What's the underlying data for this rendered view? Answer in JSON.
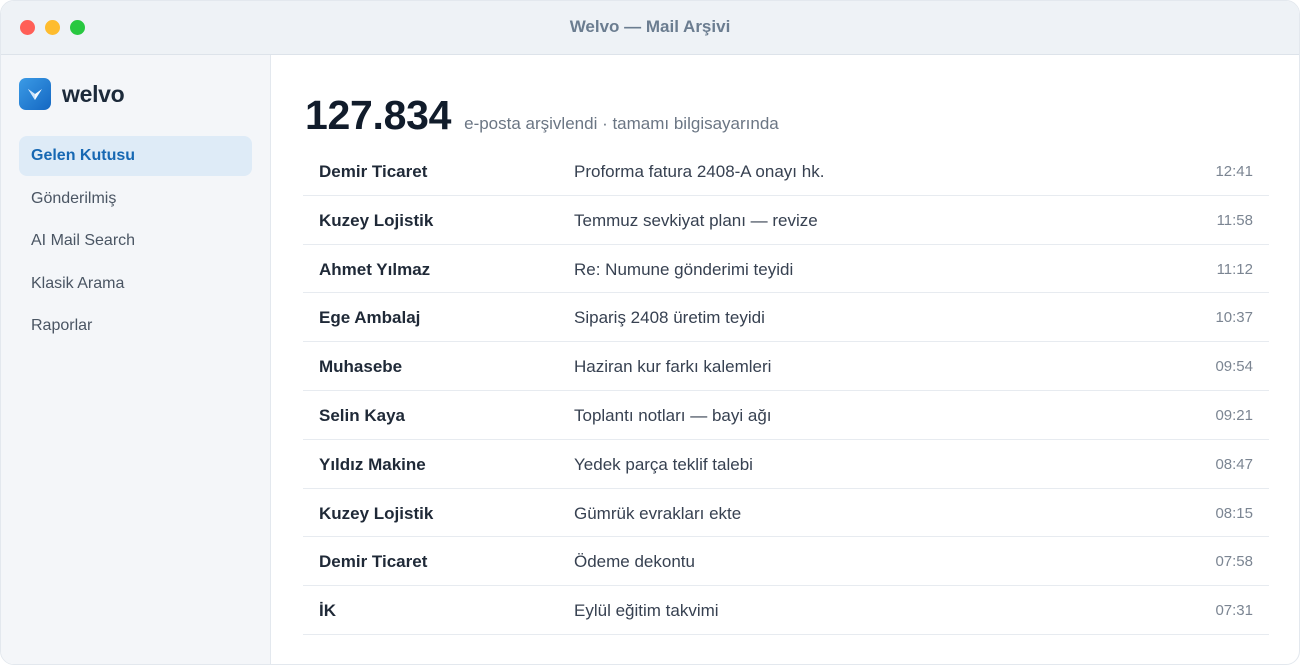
{
  "window": {
    "title": "Welvo — Mail Arşivi"
  },
  "brand": {
    "name": "welvo",
    "accent": "#1768b3"
  },
  "sidebar": {
    "items": [
      {
        "label": "Gelen Kutusu",
        "active": true
      },
      {
        "label": "Gönderilmiş",
        "active": false
      },
      {
        "label": "AI Mail Search",
        "active": false
      },
      {
        "label": "Klasik Arama",
        "active": false
      },
      {
        "label": "Raporlar",
        "active": false
      }
    ]
  },
  "main": {
    "stat_number": "127.834",
    "stat_caption": "e-posta arşivlendi · tamamı bilgisayarında"
  },
  "mails": [
    {
      "sender": "Demir Ticaret",
      "subject": "Proforma fatura 2408-A onayı hk.",
      "time": "12:41"
    },
    {
      "sender": "Kuzey Lojistik",
      "subject": "Temmuz sevkiyat planı — revize",
      "time": "11:58"
    },
    {
      "sender": "Ahmet Yılmaz",
      "subject": "Re: Numune gönderimi teyidi",
      "time": "11:12"
    },
    {
      "sender": "Ege Ambalaj",
      "subject": "Sipariş 2408 üretim teyidi",
      "time": "10:37"
    },
    {
      "sender": "Muhasebe",
      "subject": "Haziran kur farkı kalemleri",
      "time": "09:54"
    },
    {
      "sender": "Selin Kaya",
      "subject": "Toplantı notları — bayi ağı",
      "time": "09:21"
    },
    {
      "sender": "Yıldız Makine",
      "subject": "Yedek parça teklif talebi",
      "time": "08:47"
    },
    {
      "sender": "Kuzey Lojistik",
      "subject": "Gümrük evrakları ekte",
      "time": "08:15"
    },
    {
      "sender": "Demir Ticaret",
      "subject": "Ödeme dekontu",
      "time": "07:58"
    },
    {
      "sender": "İK",
      "subject": "Eylül eğitim takvimi",
      "time": "07:31"
    }
  ]
}
